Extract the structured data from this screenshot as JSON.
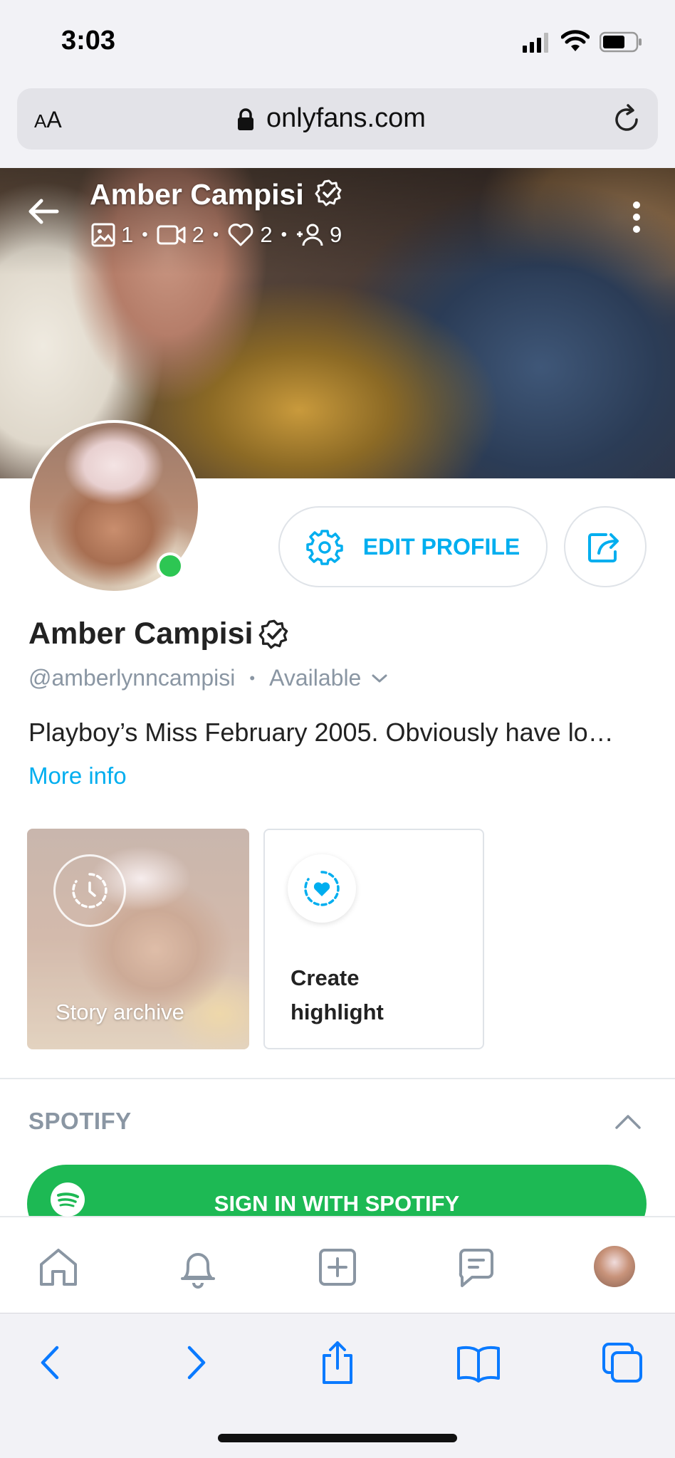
{
  "status_bar": {
    "time": "3:03"
  },
  "browser": {
    "text_size_button": "AA",
    "url": "onlyfans.com"
  },
  "profile_header": {
    "name": "Amber Campisi",
    "stats": {
      "photos": "1",
      "videos": "2",
      "likes": "2",
      "fans": "9"
    }
  },
  "actions": {
    "edit_profile": "EDIT PROFILE"
  },
  "profile": {
    "name": "Amber Campisi",
    "handle": "@amberlynncampisi",
    "status": "Available",
    "bio": "Playboy’s Miss February 2005. Obviously have lo…",
    "more_info": "More info"
  },
  "stories": {
    "archive_label": "Story archive",
    "create_highlight_label": "Create highlight"
  },
  "spotify": {
    "section_title": "SPOTIFY",
    "sign_in_label": "SIGN IN WITH SPOTIFY"
  },
  "colors": {
    "accent": "#00aeef",
    "online": "#2dc653",
    "spotify_green": "#1db954",
    "muted_text": "#8a96a3"
  },
  "app_nav": [
    "home-icon",
    "bell-icon",
    "add-post-icon",
    "messages-icon",
    "profile-avatar"
  ],
  "safari_toolbar": [
    "back-icon",
    "forward-icon",
    "share-icon",
    "bookmarks-icon",
    "tabs-icon"
  ]
}
